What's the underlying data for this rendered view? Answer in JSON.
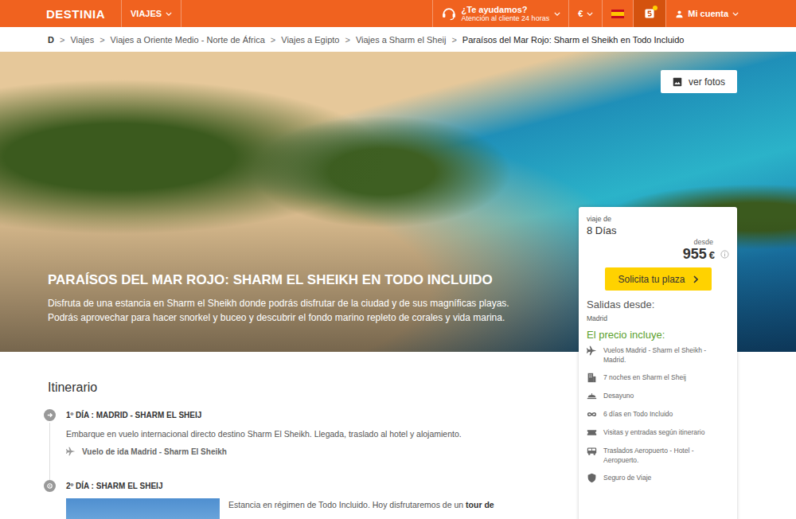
{
  "header": {
    "logo": "DESTINIA",
    "nav": [
      {
        "label": "VIAJES"
      }
    ],
    "help": {
      "title": "¿Te ayudamos?",
      "subtitle": "Atención al cliente 24 horas"
    },
    "currency": "€",
    "rewards_notification": true,
    "account": "Mi cuenta"
  },
  "breadcrumb": {
    "home": "D",
    "separator": ">",
    "items": [
      {
        "label": "Viajes",
        "current": false
      },
      {
        "label": "Viajes a Oriente Medio - Norte de África",
        "current": false
      },
      {
        "label": "Viajes a Egipto",
        "current": false
      },
      {
        "label": "Viajes a Sharm el Sheij",
        "current": false
      },
      {
        "label": "Paraísos del Mar Rojo: Sharm el Sheikh en Todo Incluido",
        "current": true
      }
    ]
  },
  "hero": {
    "title": "PARAÍSOS DEL MAR ROJO: SHARM EL SHEIKH EN TODO INCLUIDO",
    "description_lines": [
      "Disfruta de una estancia en Sharm el Sheikh donde podrás disfrutar de la ciudad y de sus magníficas playas.",
      "Podrás aprovechar para hacer snorkel y buceo y descubrir el fondo marino repleto de corales y vida marina."
    ],
    "photos_button": "ver fotos"
  },
  "price_card": {
    "duration_label": "viaje de",
    "duration": "8 Días",
    "from_label": "desde",
    "price": "955",
    "currency": "€",
    "cta": "Solicita tu plaza",
    "departures_label": "Salidas desde:",
    "departure": "Madrid",
    "includes_title": "El precio incluye:",
    "includes": [
      {
        "kind": "plane",
        "text": "Vuelos Madrid - Sharm el Sheikh - Madrid."
      },
      {
        "kind": "hotel",
        "text": "7 noches en Sharm el Sheij"
      },
      {
        "kind": "meal",
        "text": "Desayuno"
      },
      {
        "kind": "infinity",
        "text": "6 días en Todo Incluido"
      },
      {
        "kind": "ticket",
        "text": "Visitas y entradas según itinerario"
      },
      {
        "kind": "bus",
        "text": "Traslados Aeropuerto - Hotel - Aeropuerto."
      },
      {
        "kind": "shield",
        "text": "Seguro de Viaje"
      }
    ]
  },
  "itinerary": {
    "title": "Itinerario",
    "days": [
      {
        "kind": "departure",
        "title": "1º DÍA : MADRID - SHARM EL SHEIJ",
        "text": [
          {
            "text": "Embarque en vuelo internacional directo destino Sharm El Sheikh. Llegada, traslado al hotel y alojamiento.",
            "bold": false
          }
        ],
        "flight": "Vuelo de ida Madrid - Sharm El Sheikh"
      },
      {
        "kind": "stay",
        "title": "2º DÍA : SHARM EL SHEIJ",
        "text": [
          {
            "text": "Estancia en régimen de Todo Incluido. Hoy disfrutaremos de un ",
            "bold": false
          },
          {
            "text": "tour de",
            "bold": true
          }
        ],
        "flight": ""
      }
    ]
  }
}
